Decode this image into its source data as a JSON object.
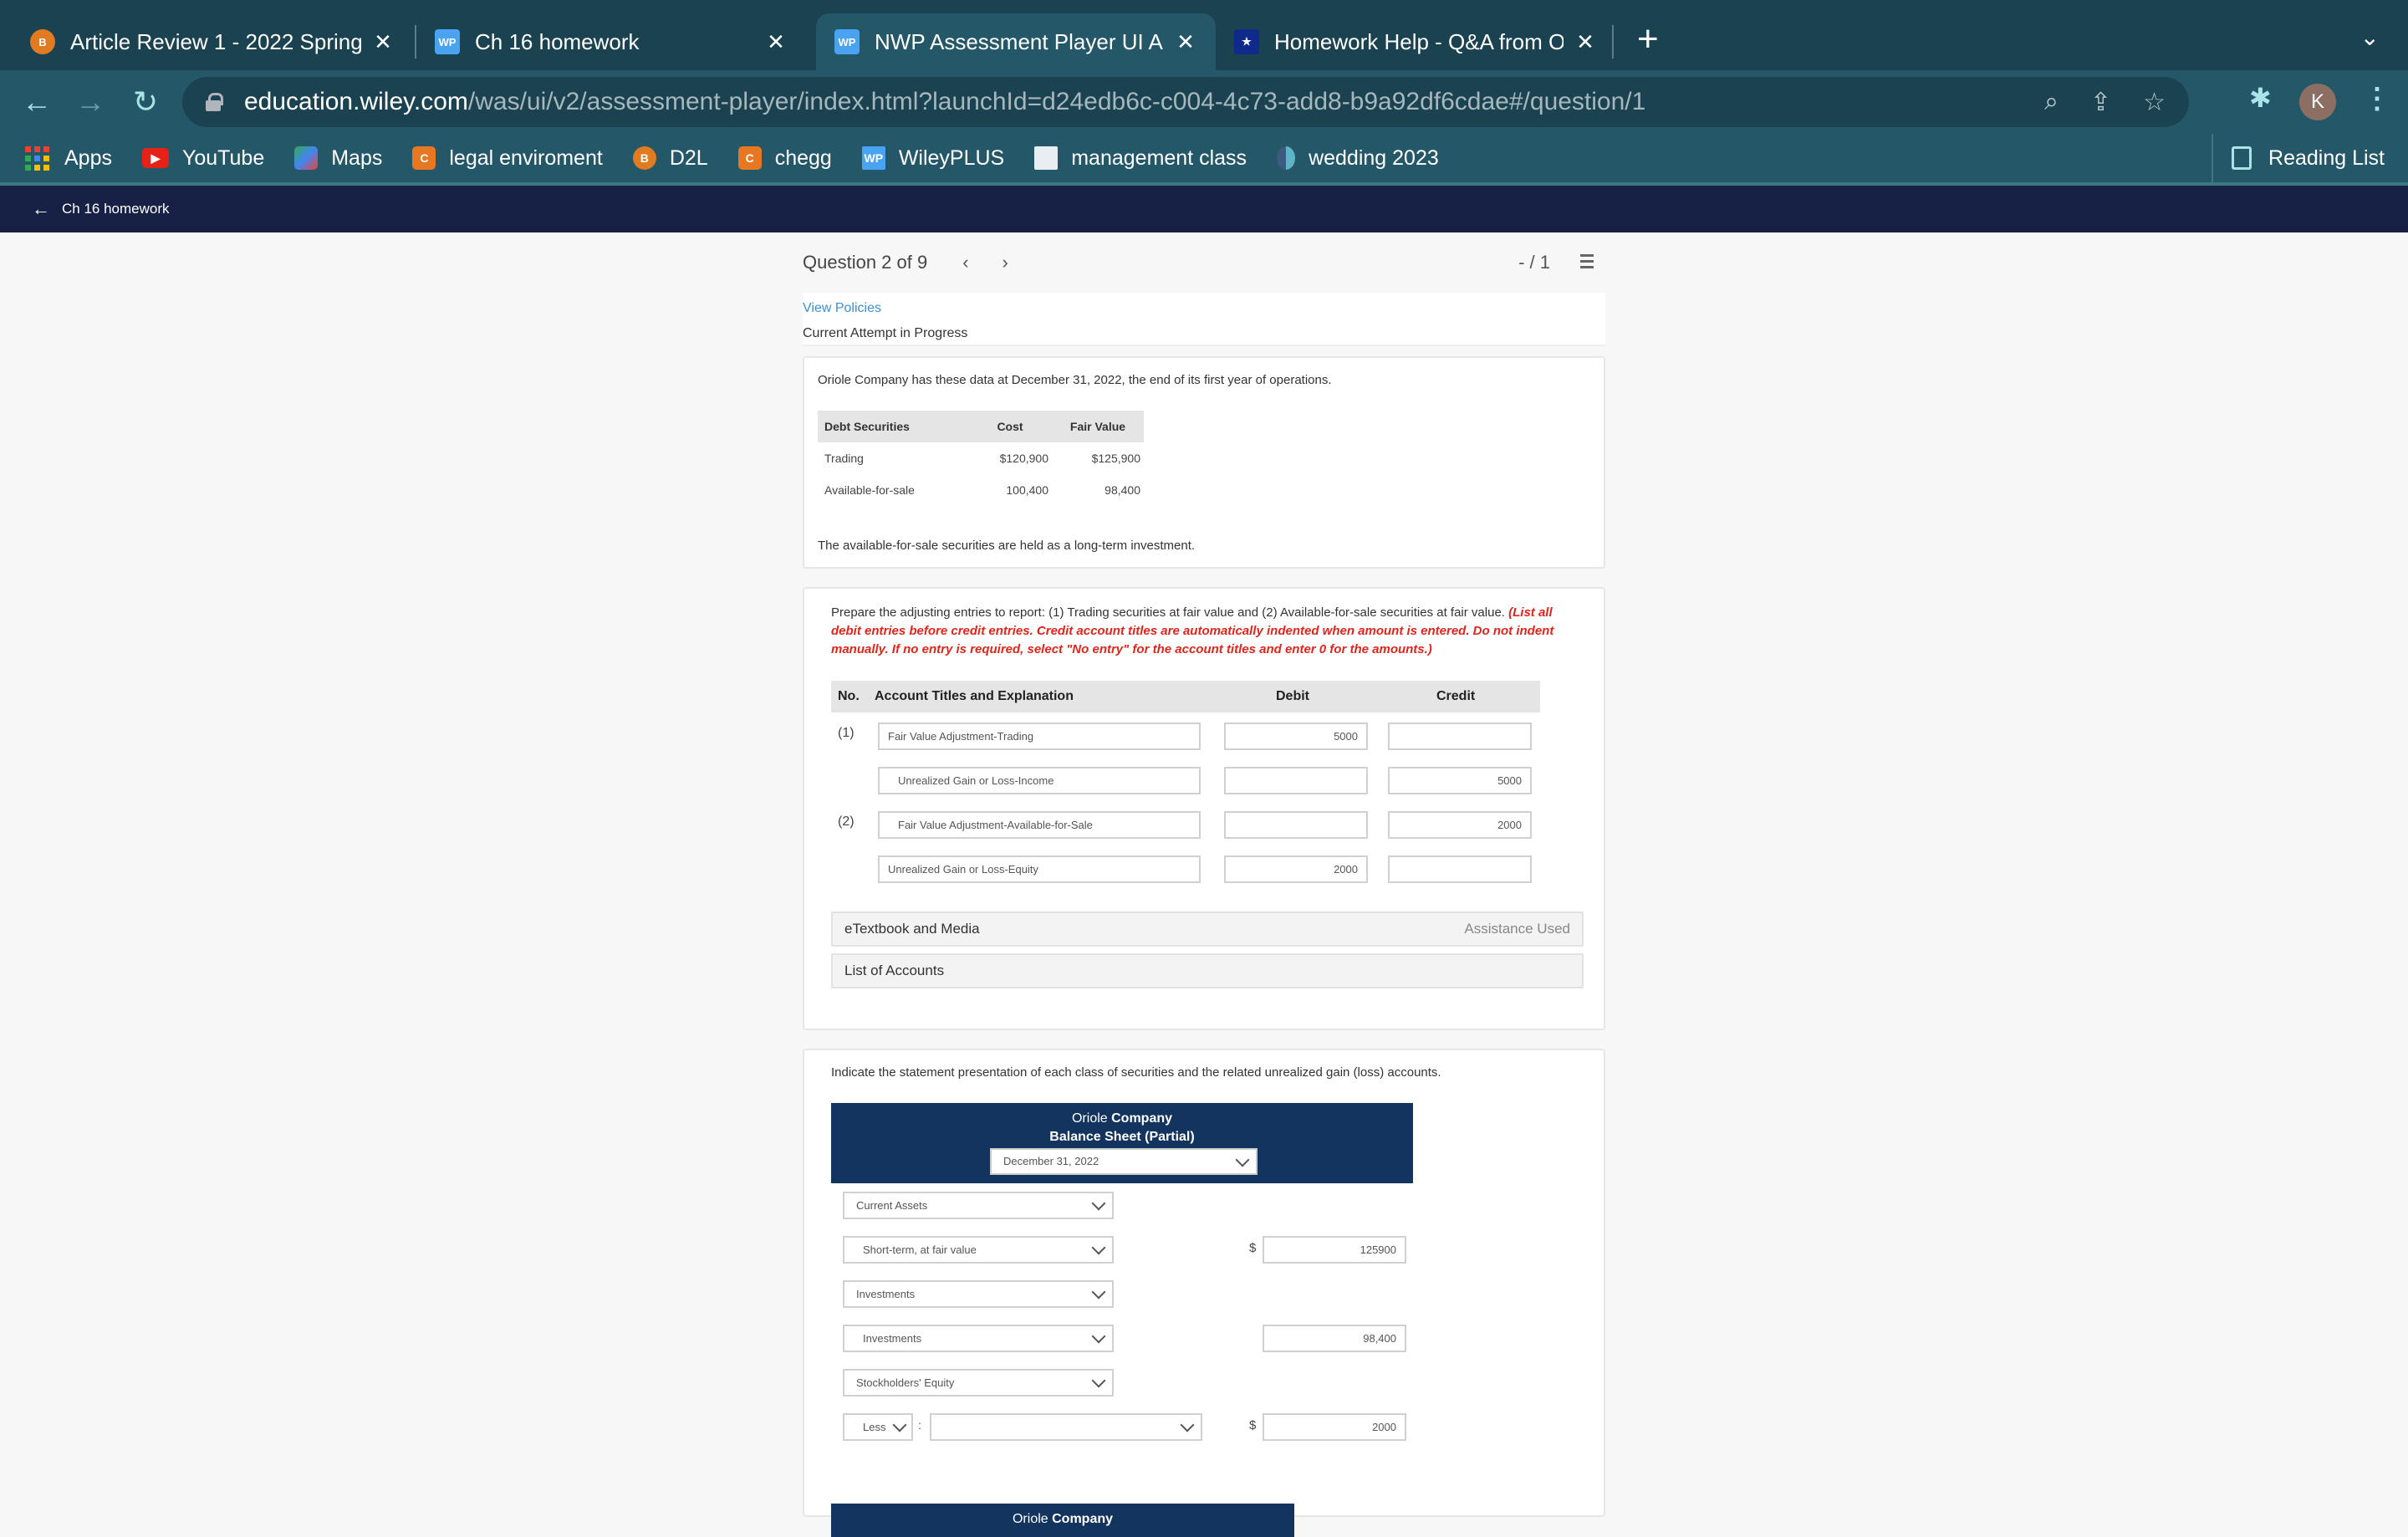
{
  "browser": {
    "tabs": [
      {
        "label": "Article Review 1 - 2022 Spring",
        "icon": "d2l-icon",
        "active": false
      },
      {
        "label": "Ch 16 homework",
        "icon": "wileyplus-icon",
        "active": false
      },
      {
        "label": "NWP Assessment Player UI App",
        "icon": "wileyplus-icon",
        "active": true
      },
      {
        "label": "Homework Help - Q&A from Online",
        "icon": "course-hero-icon",
        "active": false
      }
    ],
    "close_glyph": "✕",
    "new_tab_glyph": "+",
    "tab_menu_glyph": "⌄",
    "url_host": "education.wiley.com",
    "url_path": "/was/ui/v2/assessment-player/index.html?launchId=d24edb6c-c004-4c73-add8-b9a92df6cdae#/question/1",
    "profile_initial": "K",
    "bookmarks": [
      {
        "label": "Apps",
        "icon": "apps-grid-icon"
      },
      {
        "label": "YouTube",
        "icon": "youtube-icon"
      },
      {
        "label": "Maps",
        "icon": "maps-icon"
      },
      {
        "label": "legal enviroment",
        "icon": "chegg-icon"
      },
      {
        "label": "D2L",
        "icon": "d2l-icon"
      },
      {
        "label": "chegg",
        "icon": "chegg-icon"
      },
      {
        "label": "WileyPLUS",
        "icon": "wileyplus-icon"
      },
      {
        "label": "management class",
        "icon": "management-icon"
      },
      {
        "label": "wedding 2023",
        "icon": "heart-icon"
      }
    ],
    "reading_list": "Reading List"
  },
  "app": {
    "back_label": "Ch 16 homework",
    "question_label": "Question 2 of 9",
    "score": "- / 1",
    "view_policies": "View Policies",
    "attempt_status": "Current Attempt in Progress"
  },
  "problem": {
    "intro": "Oriole Company has these data at December 31, 2022, the end of its first year of operations.",
    "table": {
      "headers": [
        "Debt Securities",
        "Cost",
        "Fair Value"
      ],
      "rows": [
        [
          "Trading",
          "$120,900",
          "$125,900"
        ],
        [
          "Available-for-sale",
          "100,400",
          "98,400"
        ]
      ]
    },
    "note": "The available-for-sale securities are held as a long-term investment."
  },
  "part1": {
    "instruction": "Prepare the adjusting entries to report: (1) Trading securities at fair value and (2) Available-for-sale securities at fair value. ",
    "instruction_red": "(List all debit entries before credit entries. Credit account titles are automatically indented when amount is entered. Do not indent manually. If no entry is required, select \"No entry\" for the account titles and enter 0 for the amounts.)",
    "headers": {
      "no": "No.",
      "account": "Account Titles and Explanation",
      "debit": "Debit",
      "credit": "Credit"
    },
    "rows": [
      {
        "no": "(1)",
        "account": "Fair Value Adjustment-Trading",
        "debit": "5000",
        "credit": ""
      },
      {
        "no": "",
        "account": "Unrealized Gain or Loss-Income",
        "debit": "",
        "credit": "5000"
      },
      {
        "no": "(2)",
        "account": "Fair Value Adjustment-Available-for-Sale",
        "debit": "",
        "credit": "2000"
      },
      {
        "no": "",
        "account": "Unrealized Gain or Loss-Equity",
        "debit": "2000",
        "credit": ""
      }
    ],
    "etextbook": "eTextbook and Media",
    "assistance": "Assistance Used",
    "list_of_accounts": "List of Accounts"
  },
  "part2": {
    "instruction": "Indicate the statement presentation of each class of securities and the related unrealized gain (loss) accounts.",
    "company_prefix": "Oriole ",
    "company_bold": "Company",
    "statement_title": "Balance Sheet (Partial)",
    "date_select": "December 31, 2022",
    "rows": [
      {
        "select": "Current Assets",
        "dollar": "",
        "amount": null
      },
      {
        "select": "Short-term, at fair value",
        "dollar": "$",
        "amount": "125900"
      },
      {
        "select": "Investments",
        "dollar": "",
        "amount": null
      },
      {
        "select": "Investments",
        "dollar": "",
        "amount": "98,400"
      },
      {
        "select": "Stockholders' Equity",
        "dollar": "",
        "amount": null
      }
    ],
    "less_row": {
      "operator": "Less",
      "colon": ":",
      "account": "",
      "dollar": "$",
      "amount": "2000"
    },
    "next_statement_company_prefix": "Oriole ",
    "next_statement_company_bold": "Company"
  }
}
